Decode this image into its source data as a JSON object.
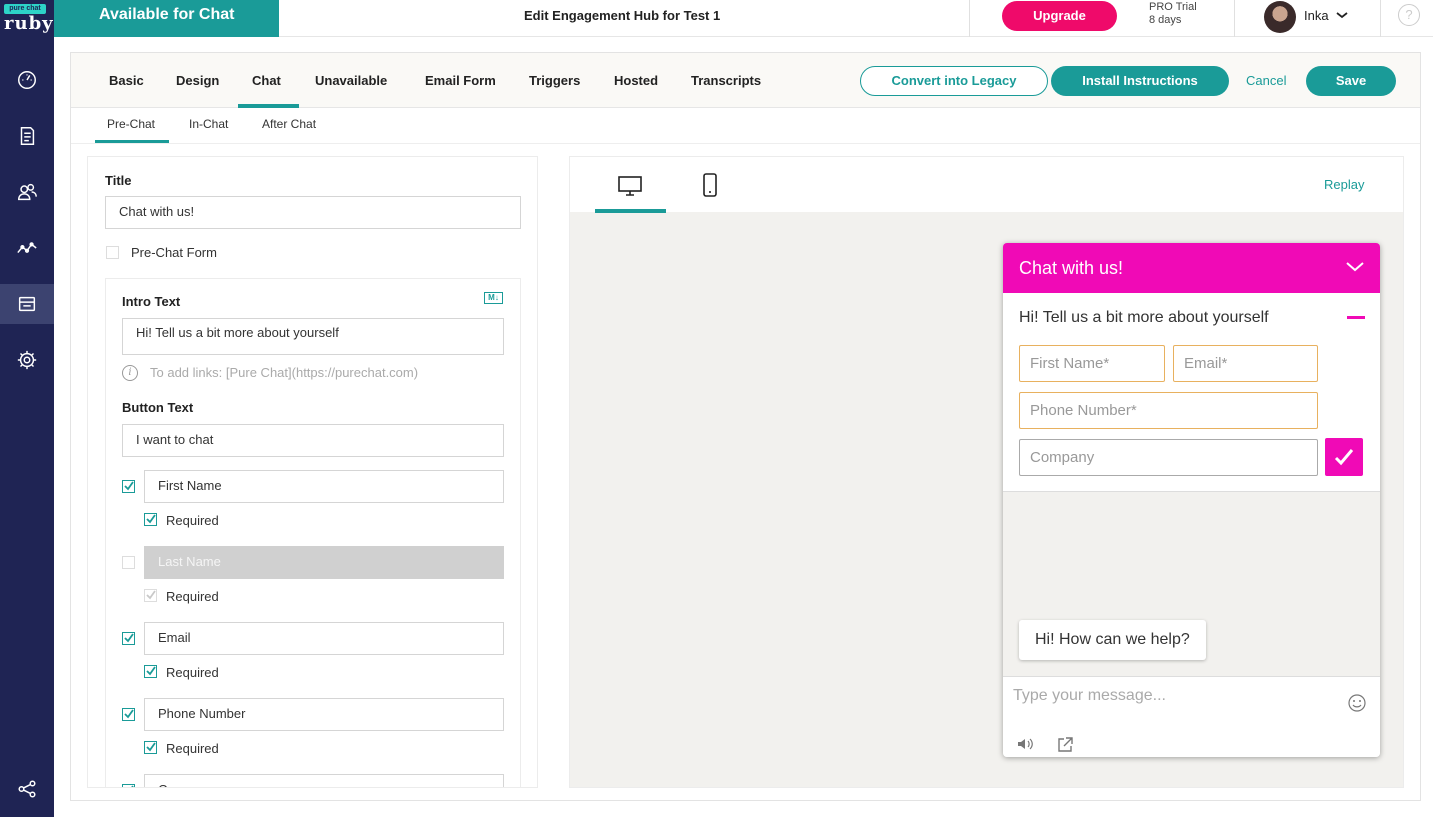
{
  "brand": {
    "badge": "pure chat",
    "name": "ruby",
    "accent": "#1a9b98",
    "pink": "#f00ab6",
    "sidebar_bg": "#1f2454"
  },
  "sidebar": {
    "items": [
      {
        "icon": "dashboard-icon"
      },
      {
        "icon": "document-icon"
      },
      {
        "icon": "users-icon"
      },
      {
        "icon": "analytics-icon"
      },
      {
        "icon": "chat-box-icon",
        "active": true
      },
      {
        "icon": "gear-icon"
      },
      {
        "icon": "share-icon"
      }
    ]
  },
  "topbar": {
    "status": "Available for Chat",
    "title": "Edit Engagement Hub for Test 1",
    "upgrade": "Upgrade",
    "trial_line1": "PRO Trial",
    "trial_line2": "8 days",
    "user": "Inka",
    "help": "?"
  },
  "tabs": [
    "Basic",
    "Design",
    "Chat",
    "Unavailable",
    "Email Form",
    "Triggers",
    "Hosted",
    "Transcripts"
  ],
  "active_tab": "Chat",
  "actions": {
    "convert": "Convert into Legacy",
    "install": "Install Instructions",
    "cancel": "Cancel",
    "save": "Save"
  },
  "subtabs": [
    "Pre-Chat",
    "In-Chat",
    "After Chat"
  ],
  "active_subtab": "Pre-Chat",
  "form": {
    "title_label": "Title",
    "title_value": "Chat with us!",
    "prechat_form_label": "Pre-Chat Form",
    "intro_label": "Intro Text",
    "markdown_badge": "M↓",
    "intro_value": "Hi! Tell us a bit more about yourself",
    "hint": "To add links: [Pure Chat](https://purechat.com)",
    "button_label": "Button Text",
    "button_value": "I want to chat",
    "fields": [
      {
        "name": "First Name",
        "enabled": true,
        "required": true
      },
      {
        "name": "Last Name",
        "enabled": false,
        "required": true
      },
      {
        "name": "Email",
        "enabled": true,
        "required": true
      },
      {
        "name": "Phone Number",
        "enabled": true,
        "required": true
      },
      {
        "name": "Company",
        "enabled": true
      }
    ],
    "required_label": "Required"
  },
  "preview": {
    "replay": "Replay",
    "widget": {
      "title": "Chat with us!",
      "intro": "Hi! Tell us a bit more about yourself",
      "first_name": "First Name*",
      "email": "Email*",
      "phone": "Phone Number*",
      "company": "Company",
      "bubble": "Hi! How can we help?",
      "message_placeholder": "Type your message..."
    }
  }
}
